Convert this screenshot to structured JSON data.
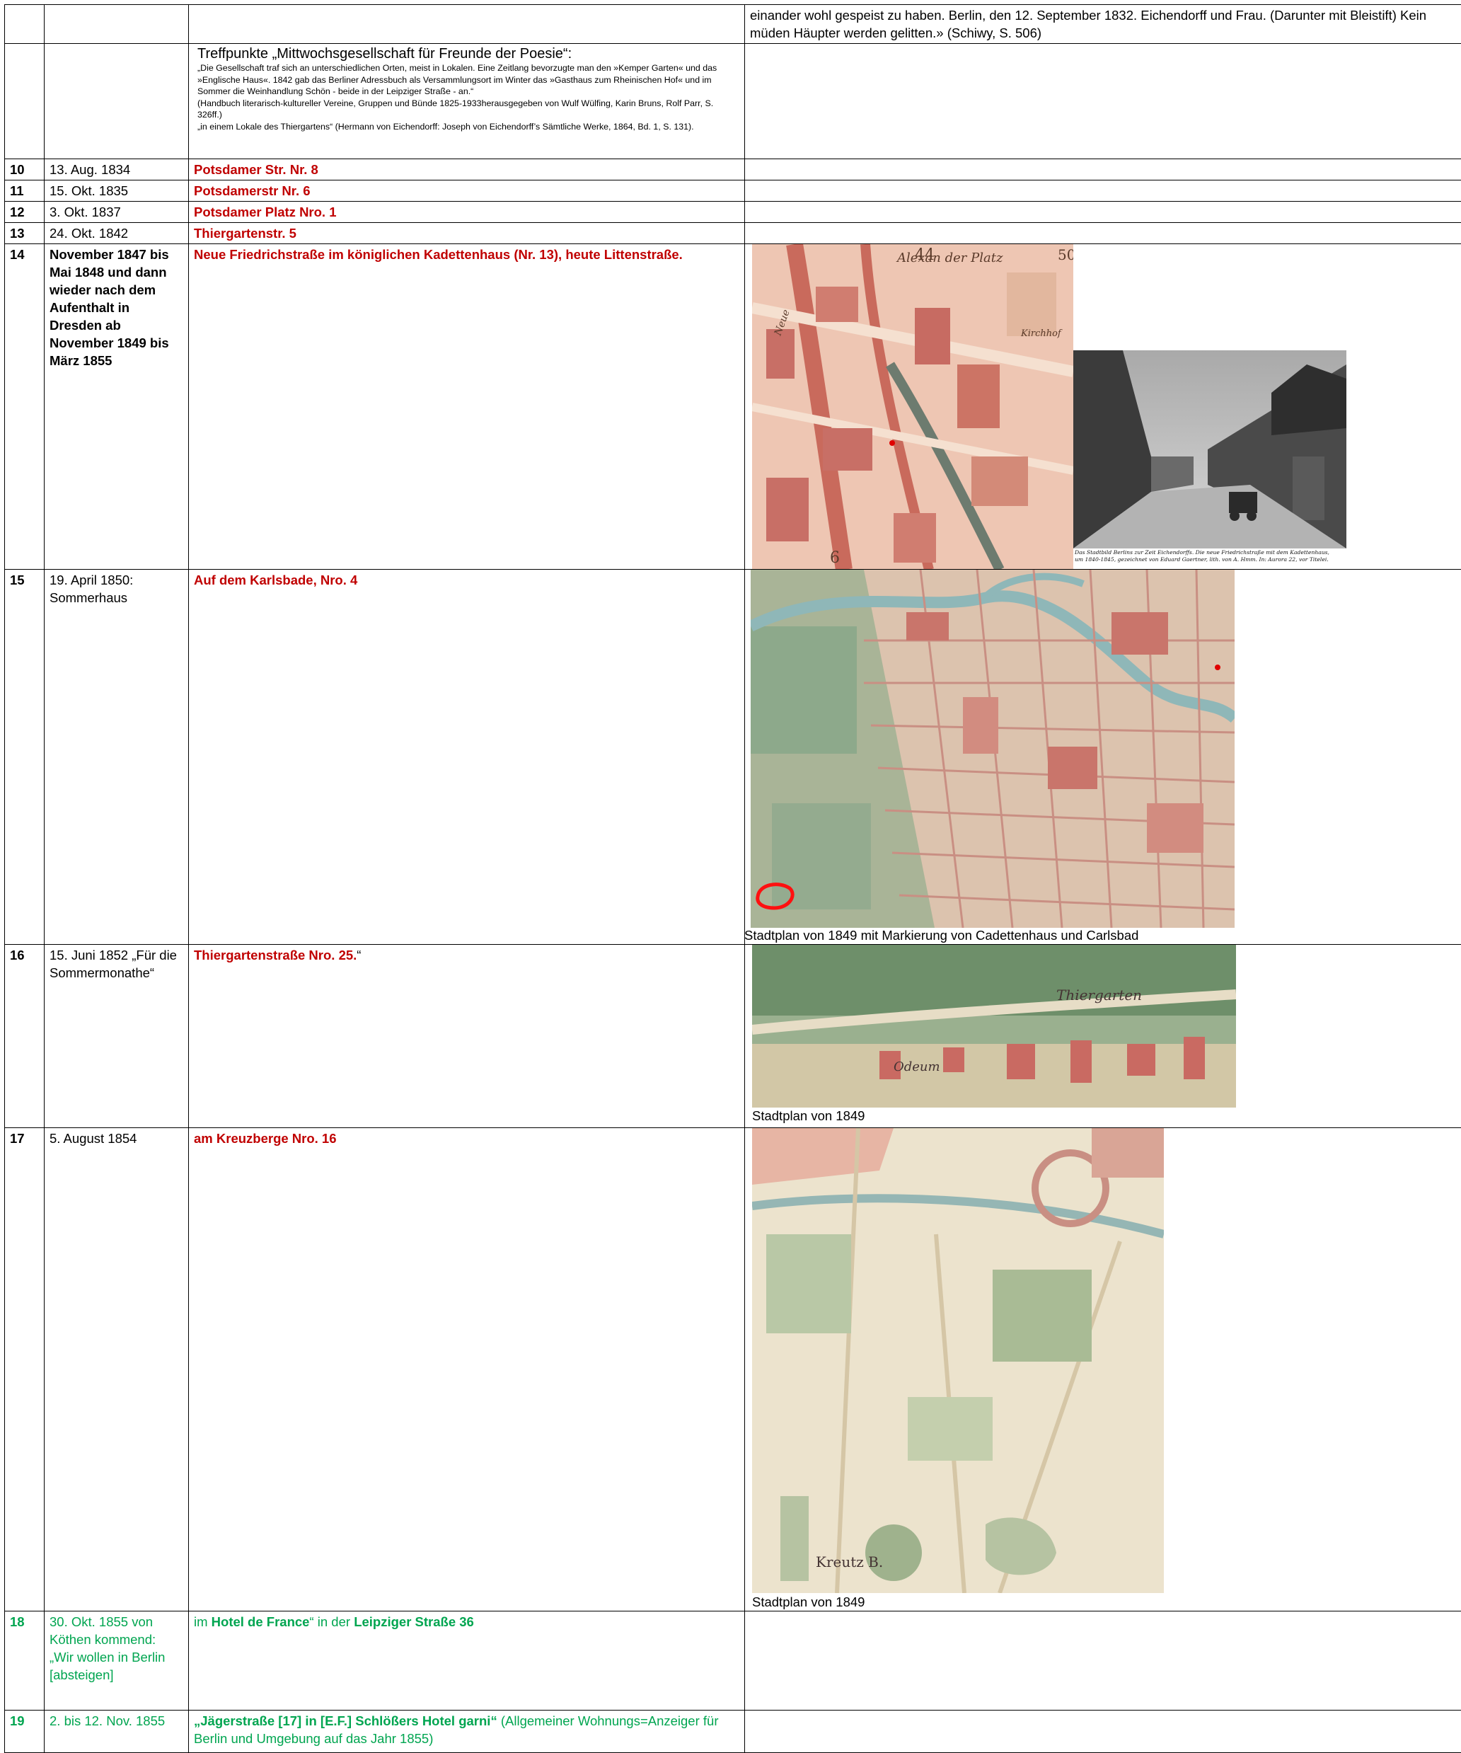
{
  "row_cont": {
    "text_line1": "einander wohl gespeist zu haben. Berlin, den 12. September 1832. Eichendorff und Frau. (Darunter mit Bleistift) Kein",
    "text_line2": "müden Häupter werden gelitten.» (Schiwy, S. 506)"
  },
  "row_treff": {
    "heading": "Treffpunkte „Mittwochsgesellschaft für Freunde der Poesie“:",
    "quote1": "„Die Gesellschaft traf sich an unterschiedlichen Orten, meist in Lokalen. Eine Zeitlang bevorzugte man den »Kemper Garten« und das »Englische Haus«. 1842 gab das Berliner Adressbuch als Versammlungsort im Winter das »Gasthaus zum Rheinischen Hof« und im Sommer die Weinhandlung Schön - beide in der Leipziger Straße - an.“",
    "source1": "(Handbuch literarisch-kultureller Vereine, Gruppen und Bünde 1825-1933herausgegeben von Wulf Wülfing, Karin Bruns, Rolf Parr, S. 326ff.)",
    "quote2": "„in einem Lokale des Thiergartens“ (Hermann von Eichendorff: Joseph von Eichendorff’s Sämtliche Werke, 1864, Bd. 1, S. 131)."
  },
  "rows": {
    "r10": {
      "num": "10",
      "date": "13. Aug. 1834",
      "address": "Potsdamer Str. Nr. 8"
    },
    "r11": {
      "num": "11",
      "date": "15. Okt. 1835",
      "address": "Potsdamerstr Nr. 6"
    },
    "r12": {
      "num": "12",
      "date": "3. Okt. 1837",
      "address": "Potsdamer Platz Nro. 1"
    },
    "r13": {
      "num": "13",
      "date": "24. Okt. 1842",
      "address": "Thiergartenstr. 5"
    },
    "r14": {
      "num": "14",
      "date": "November 1847 bis Mai 1848 und dann wieder nach dem Aufenthalt in Dresden ab November 1849 bis März 1855",
      "address": "Neue Friedrichstraße im königlichen Kadettenhaus (Nr. 13), heute Littenstraße.",
      "photo_caption_1": "Das Stadtbild Berlins zur Zeit Eichendorffs. Die neue Friedrichstraße mit dem Kadettenhaus,",
      "photo_caption_2": "um 1840-1845, gezeichnet von Eduard Gaertner, lith. von A. Hmm. In: Aurora 22, vor Titelei.",
      "map_labels": [
        "Alexan der Platz",
        "44",
        "50",
        "6",
        "Neue",
        "Kirchhof"
      ]
    },
    "r15": {
      "num": "15",
      "date": "19. April 1850: Sommerhaus",
      "address": "Auf dem Karlsbade, Nro. 4",
      "caption": "Stadtplan von 1849 mit Markierung von Cadettenhaus und Carlsbad"
    },
    "r16": {
      "num": "16",
      "date": "15. Juni 1852 „Für die Sommermonathe“",
      "address": "Thiergartenstraße Nro. 25.",
      "address_tail": "“",
      "caption": "Stadtplan von 1849",
      "map_labels": [
        "Thiergarten",
        "Odeum"
      ]
    },
    "r17": {
      "num": "17",
      "date": "5. August 1854",
      "address": "am Kreuzberge Nro. 16",
      "caption": "Stadtplan von 1849",
      "map_labels": [
        "Kreutz B."
      ]
    },
    "r18": {
      "num": "18",
      "date": "30. Okt. 1855 von Köthen kommend: „Wir wollen in Berlin [absteigen]",
      "addr_pre": "im ",
      "addr_hotel": "Hotel de France",
      "addr_mid": "“ in der ",
      "addr_street": "Leipziger Straße 36"
    },
    "r19": {
      "num": "19",
      "date": "2. bis 12. Nov. 1855",
      "addr_bold": "„Jägerstraße [17] in [E.F.] Schlößers Hotel garni“",
      "addr_rest": " (Allgemeiner Wohnungs=Anzeiger für Berlin und Umgebung auf das Jahr 1855)"
    }
  },
  "colors": {
    "address_red": "#c00000",
    "green": "#00a550"
  }
}
